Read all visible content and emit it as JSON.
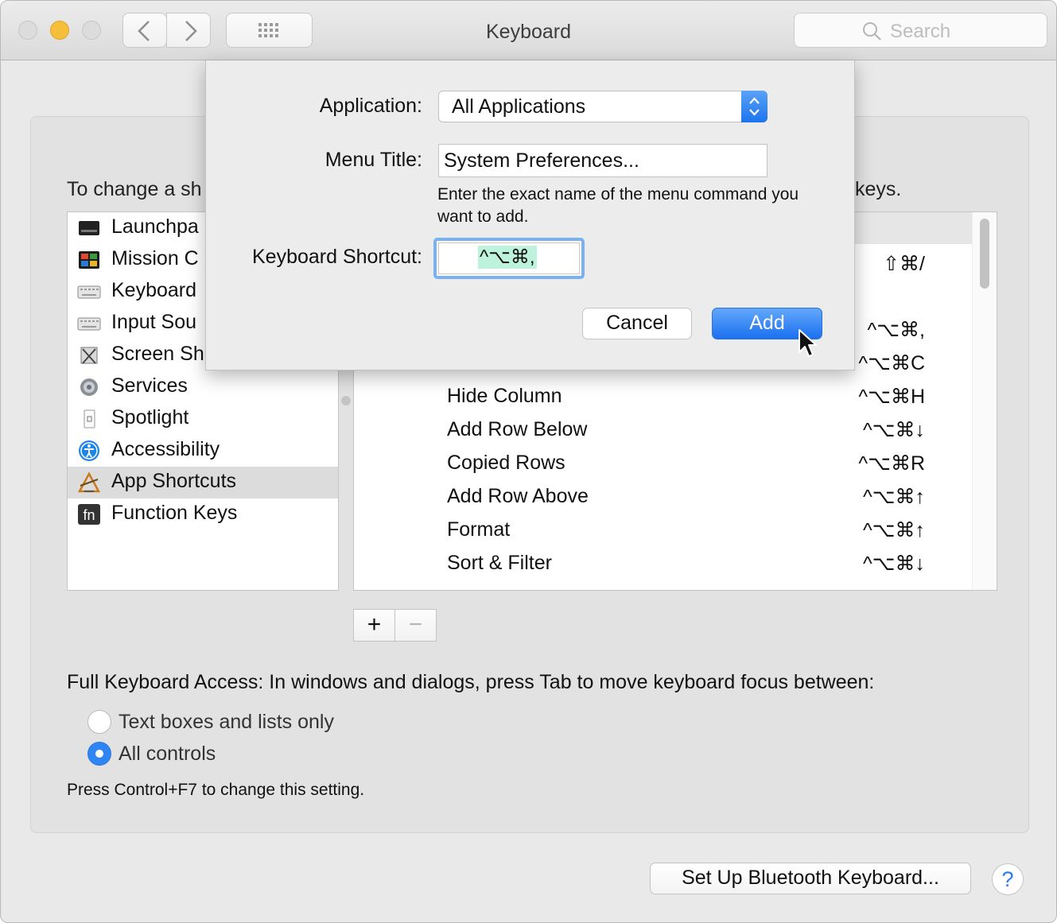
{
  "window": {
    "title": "Keyboard"
  },
  "search": {
    "placeholder": "Search"
  },
  "instructions": {
    "left": "To change a sh",
    "right": "keys."
  },
  "categories": [
    {
      "label": "Launchpa",
      "icon": "launchpad-icon"
    },
    {
      "label": "Mission C",
      "icon": "mission-control-icon"
    },
    {
      "label": "Keyboard",
      "icon": "keyboard-icon"
    },
    {
      "label": "Input Sou",
      "icon": "input-sources-icon"
    },
    {
      "label": "Screen Sh",
      "icon": "screenshot-icon"
    },
    {
      "label": "Services",
      "icon": "gear-icon"
    },
    {
      "label": "Spotlight",
      "icon": "spotlight-icon"
    },
    {
      "label": "Accessibility",
      "icon": "accessibility-icon"
    },
    {
      "label": "App Shortcuts",
      "icon": "app-shortcuts-icon",
      "selected": true
    },
    {
      "label": "Function Keys",
      "icon": "fn-icon"
    }
  ],
  "shortcuts": [
    {
      "label": "",
      "key": "⇧⌘/"
    },
    {
      "label": "",
      "key": "^⌥⌘,"
    },
    {
      "label": "",
      "key": "^⌥⌘C"
    },
    {
      "label": "Hide Column",
      "key": "^⌥⌘H"
    },
    {
      "label": "Add Row Below",
      "key": "^⌥⌘↓"
    },
    {
      "label": "Copied Rows",
      "key": "^⌥⌘R"
    },
    {
      "label": "Add Row Above",
      "key": "^⌥⌘↑"
    },
    {
      "label": "Format",
      "key": "^⌥⌘↑"
    },
    {
      "label": "Sort & Filter",
      "key": "^⌥⌘↓"
    }
  ],
  "list_buttons": {
    "add": "+",
    "remove": "−"
  },
  "full_keyboard_access": {
    "label": "Full Keyboard Access: In windows and dialogs, press Tab to move keyboard focus between:",
    "options": [
      {
        "label": "Text boxes and lists only",
        "selected": false
      },
      {
        "label": "All controls",
        "selected": true
      }
    ],
    "hint": "Press Control+F7 to change this setting."
  },
  "bottom": {
    "bluetooth_button": "Set Up Bluetooth Keyboard...",
    "help": "?"
  },
  "sheet": {
    "application_label": "Application:",
    "application_value": "All Applications",
    "menu_title_label": "Menu Title:",
    "menu_title_value": "System Preferences...",
    "description": "Enter the exact name of the menu command you want to add.",
    "shortcut_label": "Keyboard Shortcut:",
    "shortcut_value": "^⌥⌘,",
    "cancel": "Cancel",
    "add": "Add"
  },
  "colors": {
    "accent": "#1b70ef",
    "shortcut_highlight": "#bdf3dd",
    "selection": "#dcdcdc"
  }
}
